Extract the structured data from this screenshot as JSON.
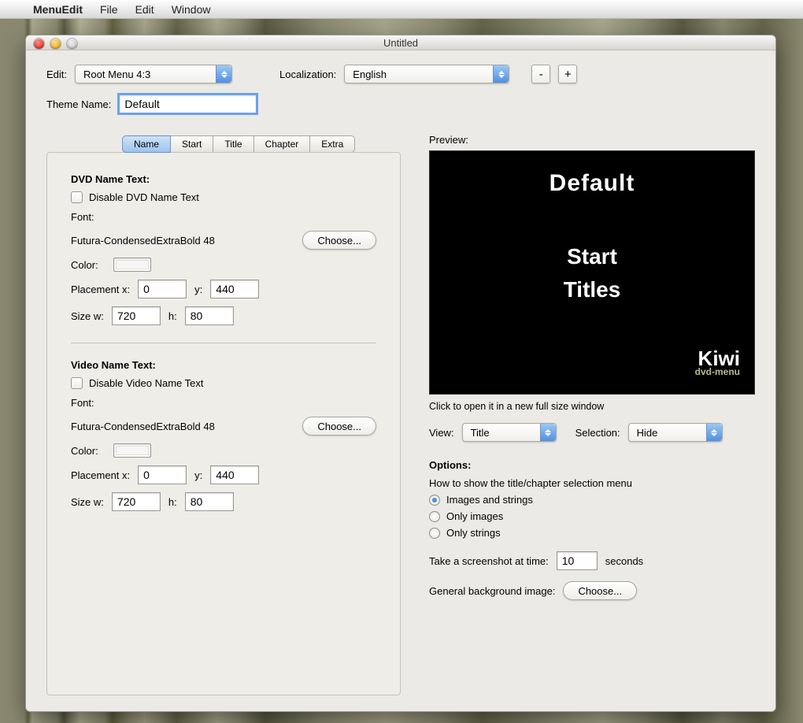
{
  "menubar": {
    "app": "MenuEdit",
    "items": [
      "File",
      "Edit",
      "Window"
    ]
  },
  "window": {
    "title": "Untitled"
  },
  "header": {
    "edit_label": "Edit:",
    "edit_value": "Root Menu 4:3",
    "loc_label": "Localization:",
    "loc_value": "English",
    "minus": "-",
    "plus": "+",
    "theme_label": "Theme Name:",
    "theme_value": "Default"
  },
  "tabs": [
    "Name",
    "Start",
    "Title",
    "Chapter",
    "Extra"
  ],
  "dvd_section": {
    "title": "DVD Name Text:",
    "disable_label": "Disable DVD Name Text",
    "font_label": "Font:",
    "font_value": "Futura-CondensedExtraBold 48",
    "choose": "Choose...",
    "color_label": "Color:",
    "placement_x_label": "Placement x:",
    "placement_x": "0",
    "y_label": "y:",
    "placement_y": "440",
    "size_w_label": "Size w:",
    "size_w": "720",
    "h_label": "h:",
    "size_h": "80"
  },
  "video_section": {
    "title": "Video Name Text:",
    "disable_label": "Disable Video Name Text",
    "font_label": "Font:",
    "font_value": "Futura-CondensedExtraBold 48",
    "choose": "Choose...",
    "color_label": "Color:",
    "placement_x_label": "Placement x:",
    "placement_x": "0",
    "y_label": "y:",
    "placement_y": "440",
    "size_w_label": "Size w:",
    "size_w": "720",
    "h_label": "h:",
    "size_h": "80"
  },
  "preview": {
    "label": "Preview:",
    "default": "Default",
    "start": "Start",
    "titles": "Titles",
    "kiwi_top": "Kiwi",
    "kiwi_bottom": "dvd-menu",
    "hint": "Click to open it in a new full size window",
    "view_label": "View:",
    "view_value": "Title",
    "selection_label": "Selection:",
    "selection_value": "Hide"
  },
  "options": {
    "title": "Options:",
    "how_label": "How to show the title/chapter selection menu",
    "radio1": "Images and strings",
    "radio2": "Only images",
    "radio3": "Only strings",
    "screenshot_label": "Take a screenshot at time:",
    "screenshot_value": "10",
    "seconds": "seconds",
    "bg_label": "General background image:",
    "choose": "Choose..."
  }
}
